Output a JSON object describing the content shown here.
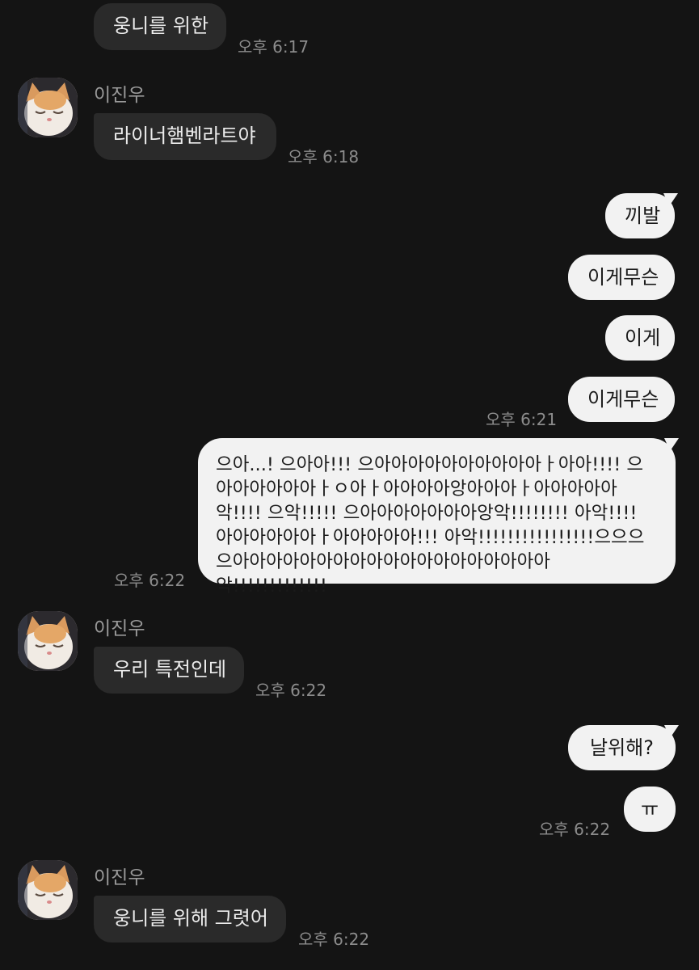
{
  "messages": [
    {
      "text": "웅니를 위한",
      "time": "오후 6:17"
    },
    {
      "sender": "이진우",
      "text": "라이너햄벤라트야",
      "time": "오후 6:18"
    },
    {
      "text": "끼발"
    },
    {
      "text": "이게무슨"
    },
    {
      "text": "이게"
    },
    {
      "text": "이게무슨",
      "time": "오후 6:21"
    },
    {
      "text": "으아...! 으아아!!! 으아아아아아아아아아아ㅏ아아!!!! 으아아아아아아ㅏㅇ아ㅏ아아아아앙아아아ㅏ아아아아아악!!!! 으악!!!!! 으아아아아아아아앙악!!!!!!!! 아악!!!! 아아아아아아ㅏ아아아아아!!! 아악!!!!!!!!!!!!!!!!으으으으아아아아아아아아아아아아아아아아아아아악!!!!!!!!!!!!!",
      "time": "오후 6:22"
    },
    {
      "sender": "이진우",
      "text": "우리 특전인데",
      "time": "오후 6:22"
    },
    {
      "text": "날위해?"
    },
    {
      "text": "ㅠ",
      "time": "오후 6:22"
    },
    {
      "sender": "이진우",
      "text": "웅니를 위해 그렷어",
      "time": "오후 6:22"
    }
  ],
  "colors": {
    "background": "#141414",
    "incoming_bubble": "#2a2a2a",
    "outgoing_bubble": "#f2f2f2",
    "timestamp": "#8c8c8c",
    "sender_name": "#9a9a9a"
  },
  "icons": {
    "avatar": "cat-avatar-icon"
  }
}
